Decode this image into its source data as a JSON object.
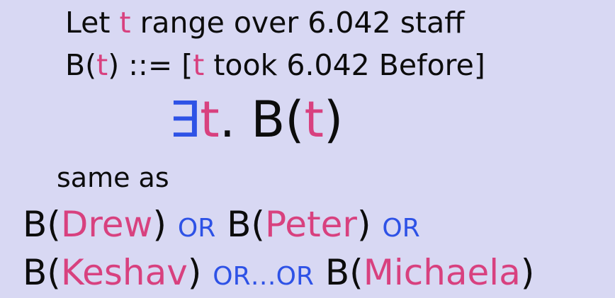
{
  "slide": {
    "line1": {
      "prefix": "Let ",
      "var": "t",
      "suffix": " range over 6.042 staff"
    },
    "line2": {
      "pred_open": "B(",
      "var": "t",
      "def": ") ::= [",
      "var2": "t",
      "rest": " took 6.042 Before]"
    },
    "formula": {
      "exists": "∃",
      "var": "t",
      "dot": ". B(",
      "var2": "t",
      "close": ")"
    },
    "same_as": "same as",
    "disjunction_line1": {
      "b1_open": "B(",
      "name1": "Drew",
      "b1_close": ")",
      "or1": "OR",
      "b2_open": "B(",
      "name2": "Peter",
      "b2_close": ")",
      "or2": "OR"
    },
    "disjunction_line2": {
      "b1_open": "B(",
      "name1": "Keshav",
      "b1_close": ")",
      "or_ellipsis": "OR…OR",
      "b2_open": "B(",
      "name2": "Michaela",
      "b2_close": ")"
    },
    "colors": {
      "background": "#d8d8f3",
      "text": "#0c0c0c",
      "variable": "#d8417f",
      "operator": "#2e52e6"
    }
  }
}
